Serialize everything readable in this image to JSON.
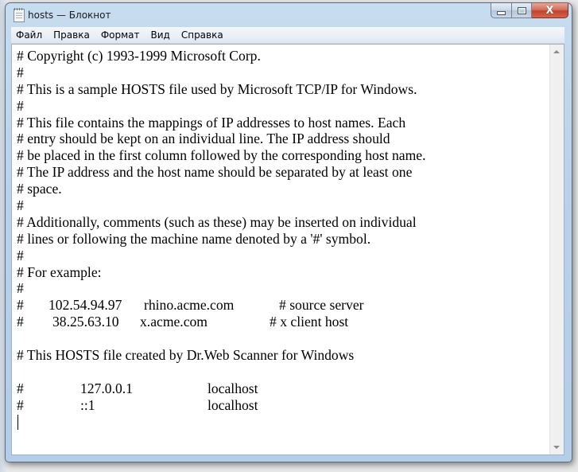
{
  "window": {
    "title": "hosts — Блокнот",
    "app_icon": "notepad-icon",
    "caption_buttons": {
      "minimize": "minimize-icon",
      "maximize": "maximize-icon",
      "close": "close-icon",
      "close_glyph": "X"
    }
  },
  "menu": {
    "items": [
      {
        "label": "Файл"
      },
      {
        "label": "Правка"
      },
      {
        "label": "Формат"
      },
      {
        "label": "Вид"
      },
      {
        "label": "Справка"
      }
    ]
  },
  "editor": {
    "lines": [
      {
        "segments": [
          "# Copyright (c) 1993-1999 Microsoft Corp."
        ]
      },
      {
        "segments": [
          "#"
        ]
      },
      {
        "segments": [
          "# This is a sample HOSTS file used by Microsoft TCP/IP for Windows."
        ]
      },
      {
        "segments": [
          "#"
        ]
      },
      {
        "segments": [
          "# This file contains the mappings of IP addresses to host names. Each"
        ]
      },
      {
        "segments": [
          "# entry should be kept on an individual line. The IP address should"
        ]
      },
      {
        "segments": [
          "# be placed in the first column followed by the corresponding host name."
        ]
      },
      {
        "segments": [
          "# The IP address and the host name should be separated by at least one"
        ]
      },
      {
        "segments": [
          "# space."
        ]
      },
      {
        "segments": [
          "#"
        ]
      },
      {
        "segments": [
          "# Additionally, comments (such as these) may be inserted on individual"
        ]
      },
      {
        "segments": [
          "# lines or following the machine name denoted by a '#' symbol."
        ]
      },
      {
        "segments": [
          "#"
        ]
      },
      {
        "segments": [
          "# For example:"
        ]
      },
      {
        "segments": [
          "#"
        ]
      },
      {
        "segments": [
          "#",
          "102.54.94.97",
          "rhino.acme.com",
          "# source server"
        ]
      },
      {
        "segments": [
          "#",
          "38.25.63.10",
          "x.acme.com",
          "# x client host"
        ]
      },
      {
        "segments": [
          ""
        ]
      },
      {
        "segments": [
          "# This HOSTS file created by Dr.Web Scanner for Windows"
        ]
      },
      {
        "segments": [
          ""
        ]
      },
      {
        "segments": [
          "#",
          "127.0.0.1",
          "localhost"
        ]
      },
      {
        "segments": [
          "#",
          "::1",
          "localhost"
        ]
      },
      {
        "segments": [
          ""
        ]
      }
    ]
  },
  "scrollbar": {
    "up_arrow": "scroll-up-arrow-icon",
    "down_arrow": "scroll-down-arrow-icon"
  }
}
